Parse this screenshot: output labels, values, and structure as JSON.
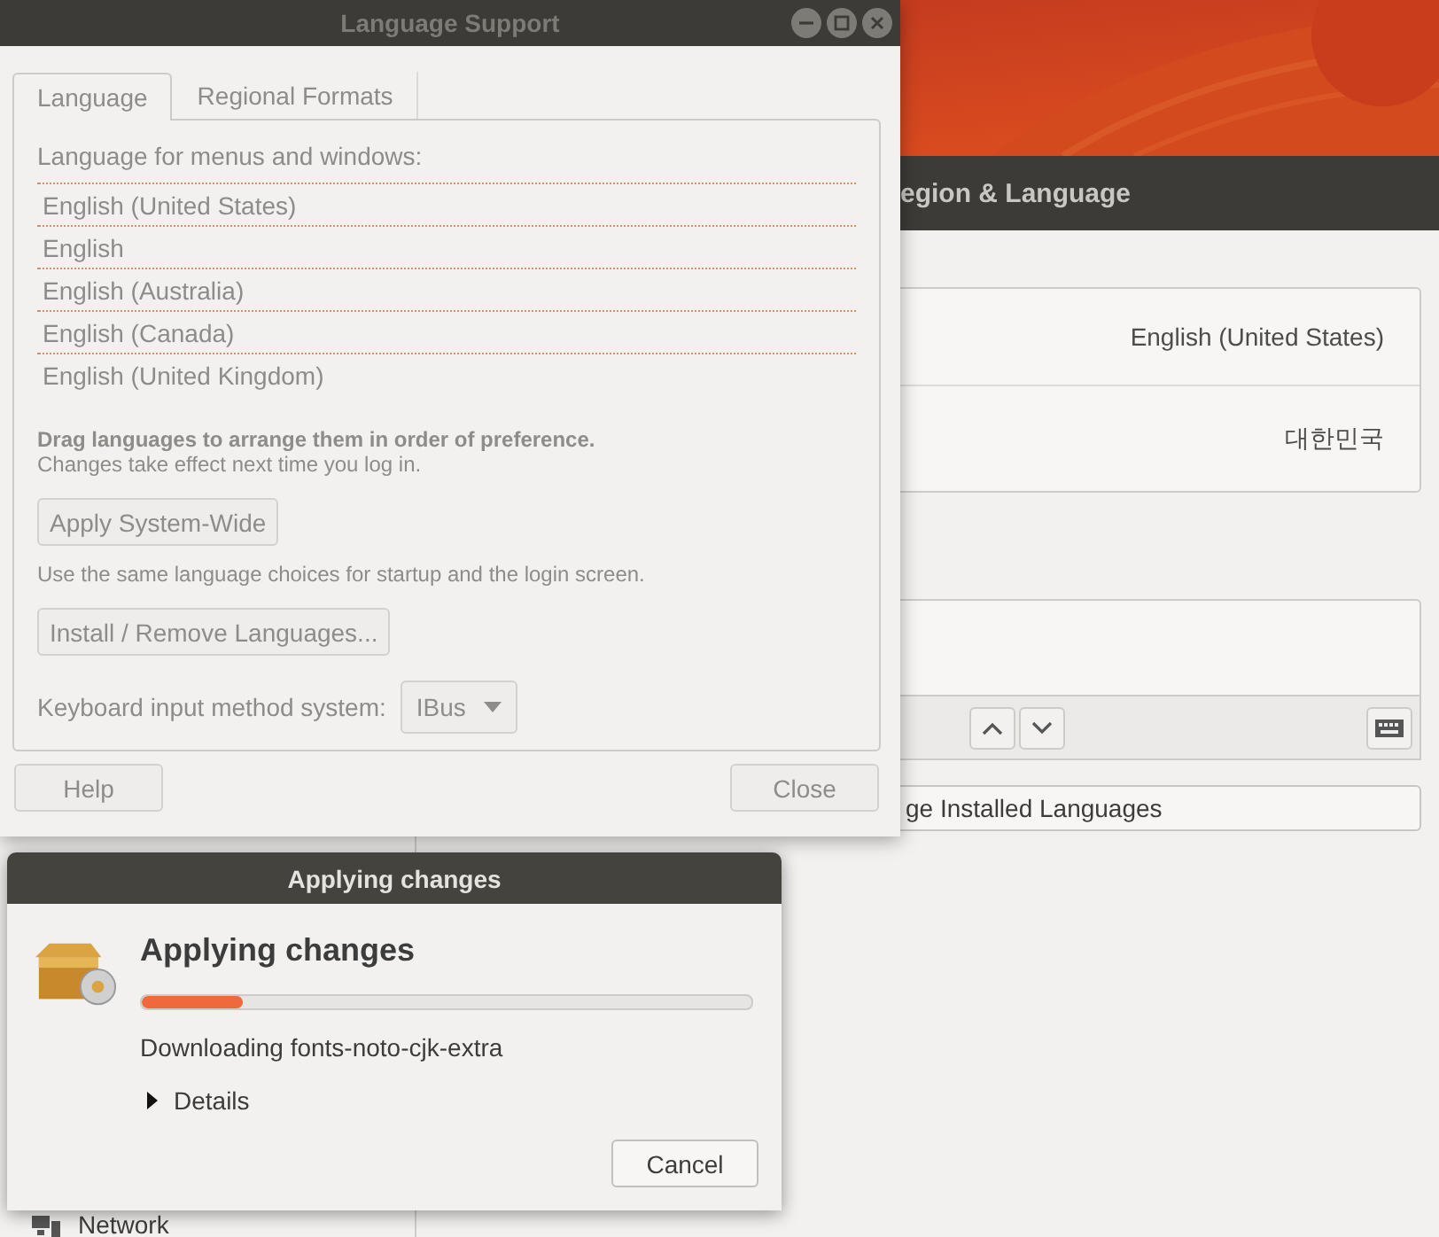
{
  "settings_window": {
    "header_title": "egion & Language",
    "sidebar_items": [
      {
        "label": "Network"
      }
    ],
    "values": [
      "English (United States)",
      "대한민국"
    ],
    "manage_button": "ge Installed Languages"
  },
  "language_support": {
    "title": "Language Support",
    "tabs": [
      {
        "label": "Language",
        "selected": true
      },
      {
        "label": "Regional Formats",
        "selected": false
      }
    ],
    "list_heading": "Language for menus and windows:",
    "languages": [
      "English (United States)",
      "English",
      "English (Australia)",
      "English (Canada)",
      "English (United Kingdom)"
    ],
    "drag_hint": "Drag languages to arrange them in order of preference.",
    "restart_note": "Changes take effect next time you log in.",
    "apply_button": "Apply System-Wide",
    "apply_note": "Use the same language choices for startup and the login screen.",
    "install_button": "Install / Remove Languages...",
    "keyboard_label": "Keyboard input method system:",
    "keyboard_value": "IBus",
    "help_button": "Help",
    "close_button": "Close"
  },
  "applying_dialog": {
    "title": "Applying changes",
    "heading": "Applying changes",
    "level": 0.165,
    "status": "Downloading fonts-noto-cjk-extra",
    "details": {
      "label": "Details",
      "expanded": false
    },
    "cancel_button": "Cancel"
  }
}
